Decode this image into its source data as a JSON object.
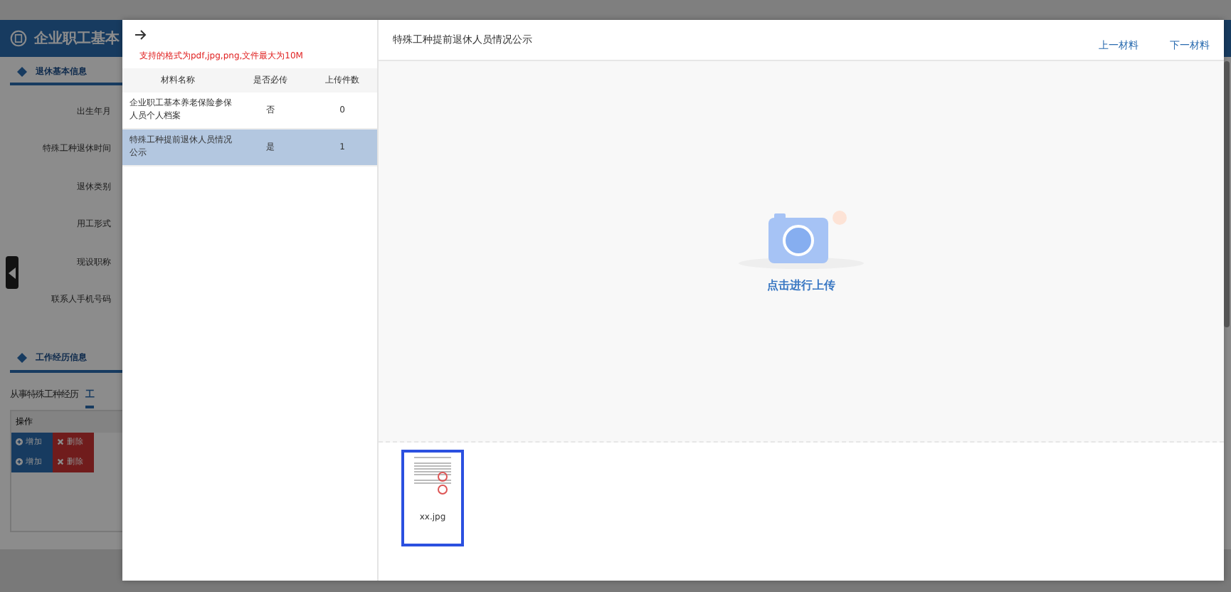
{
  "page": {
    "title": "企业职工基本",
    "sections": [
      {
        "title": "退休基本信息"
      },
      {
        "title": "工作经历信息"
      }
    ],
    "form_labels": [
      "出生年月",
      "特殊工种退休时间",
      "退休类别",
      "用工形式",
      "现设职称",
      "联系人手机号码"
    ],
    "tabs": [
      {
        "label": "从事特殊工种经历",
        "selected": false
      },
      {
        "label": "工",
        "selected": true
      }
    ],
    "table": {
      "header": "操作",
      "rows": [
        {
          "add": "增加",
          "remove": "删除"
        },
        {
          "add": "增加",
          "remove": "删除"
        }
      ]
    }
  },
  "modal": {
    "hint": "支持的格式为pdf,jpg,png,文件最大为10M",
    "columns": [
      "材料名称",
      "是否必传",
      "上传件数"
    ],
    "rows": [
      {
        "name": "企业职工基本养老保险参保人员个人档案",
        "required": "否",
        "count": "0",
        "selected": false
      },
      {
        "name": "特殊工种提前退休人员情况公示",
        "required": "是",
        "count": "1",
        "selected": true
      }
    ],
    "title": "特殊工种提前退休人员情况公示",
    "nav": [
      "上一材料",
      "下一材料"
    ],
    "upload_text": "点击进行上传",
    "files": [
      {
        "name": "xx.jpg",
        "selected": true
      }
    ]
  }
}
